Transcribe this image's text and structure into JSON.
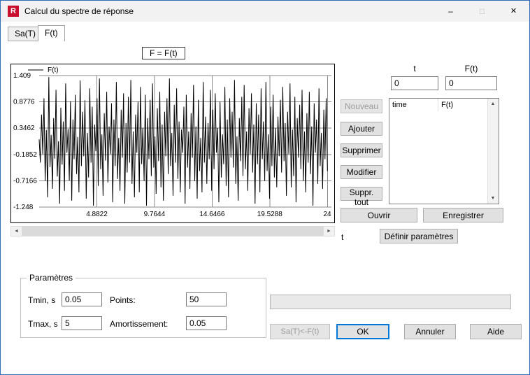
{
  "window": {
    "title": "Calcul du spectre de réponse",
    "icon_text": "R",
    "minimize_glyph": "–",
    "maximize_glyph": "□",
    "close_glyph": "✕"
  },
  "tabs": [
    {
      "label": "Sa(T)",
      "active": false
    },
    {
      "label": "F(t)",
      "active": true
    }
  ],
  "formula": "F = F(t)",
  "chart_data": {
    "type": "line",
    "legend": "F(t)",
    "xlabel": "t",
    "ylabel": "F(t)",
    "xlim": [
      0,
      24.75
    ],
    "x_end": 24.411,
    "ylim": [
      -1.248,
      1.409
    ],
    "x_ticks": [
      4.8822,
      9.7644,
      14.6466,
      19.5288,
      24.411
    ],
    "x_tick_labels": [
      "4.8822",
      "9.7644",
      "14.6466",
      "19.5288",
      "24"
    ],
    "y_ticks": [
      1.409,
      0.8776,
      0.3462,
      -0.1852,
      -0.7166,
      -1.248
    ],
    "y_tick_labels": [
      "1.409",
      "0.8776",
      "0.3462",
      "-0.1852",
      "-0.7166",
      "-1.248"
    ],
    "grid": true,
    "values": [
      0.12,
      -0.35,
      0.62,
      -0.18,
      0.95,
      -0.72,
      0.31,
      -1.05,
      1.38,
      -0.44,
      0.21,
      -0.88,
      0.55,
      -0.27,
      1.12,
      -0.63,
      0.08,
      -1.18,
      0.76,
      -0.39,
      0.48,
      -0.92,
      1.25,
      -0.15,
      0.33,
      -0.71,
      0.89,
      -1.12,
      0.52,
      -0.28,
      1.02,
      -0.58,
      0.17,
      -0.95,
      1.31,
      -0.42,
      0.68,
      -0.22,
      0.91,
      -1.08,
      0.25,
      -0.65,
      1.15,
      -0.35,
      0.78,
      -1.22,
      0.42,
      -0.12,
      0.95,
      -0.82,
      1.35,
      -0.48,
      0.22,
      -1.02,
      0.65,
      -0.31,
      1.08,
      -0.75,
      0.38,
      -0.18,
      0.85,
      -1.15,
      0.52,
      -0.42,
      1.28,
      -0.68,
      0.15,
      -0.92,
      0.72,
      -0.25,
      1.05,
      -1.18,
      0.45,
      -0.55,
      0.98,
      -0.35,
      1.32,
      -0.78,
      0.28,
      -1.05,
      0.62,
      -0.15,
      0.88,
      -0.95,
      1.18,
      -0.38,
      0.35,
      -0.72,
      1.02,
      -1.22,
      0.55,
      -0.28,
      0.92,
      -0.62,
      1.25,
      -0.45,
      0.18,
      -0.98,
      0.75,
      -0.32,
      1.08,
      -0.85,
      0.42,
      -1.12,
      0.68,
      -0.22,
      0.95,
      -0.58,
      1.35,
      -0.42,
      0.25,
      -1.02,
      0.82,
      -0.35,
      1.15,
      -0.68,
      0.48,
      -0.95,
      0.32,
      -0.15,
      0.78,
      -1.18,
      1.02,
      -0.45,
      0.28,
      -0.88,
      0.65,
      -0.25,
      1.22,
      -0.72,
      0.38,
      -1.08,
      0.92,
      -0.52,
      0.15,
      -0.95,
      1.28,
      -0.35,
      0.58,
      -0.78,
      0.45,
      -0.28,
      1.12,
      -0.92,
      0.72,
      -0.48,
      1.05,
      -0.15,
      0.35,
      -1.15,
      0.88,
      -0.65,
      0.22,
      -0.38,
      1.18,
      -0.82,
      0.52,
      -1.05,
      0.95,
      -0.25,
      0.68,
      -0.45,
      1.32,
      -0.78,
      0.18,
      -1.12,
      0.55,
      -0.32,
      0.98,
      -0.62,
      1.22,
      -0.48,
      0.28,
      -0.92,
      0.75,
      -0.18,
      1.05,
      -0.55,
      0.42,
      -1.18,
      0.85,
      -0.38,
      0.62,
      -0.95,
      1.15,
      -0.28,
      0.48,
      -0.72,
      1.28,
      -0.52,
      0.22,
      -1.08,
      0.78,
      -0.42,
      1.02,
      -0.65,
      0.35,
      -0.85,
      0.58,
      -0.22,
      0.92,
      -0.55,
      1.18,
      -0.32,
      0.45,
      -1.02,
      0.68,
      -0.18,
      1.25,
      -0.85,
      0.32,
      -0.62,
      0.98,
      -1.15,
      0.55,
      -0.25,
      0.82,
      -0.48,
      1.12,
      -0.72,
      0.28,
      -0.95,
      0.65,
      -0.35,
      1.08,
      -0.58,
      0.38,
      -1.22,
      0.85,
      -0.15,
      0.52,
      -0.78,
      1.15,
      -0.42,
      0.25,
      -0.88,
      0.72,
      -0.28,
      0.95,
      -0.52
    ]
  },
  "point_entry": {
    "t_label": "t",
    "ft_label": "F(t)",
    "t_value": "0",
    "ft_value": "0"
  },
  "edit_buttons": [
    {
      "label": "Nouveau",
      "enabled": false
    },
    {
      "label": "Ajouter",
      "enabled": true
    },
    {
      "label": "Supprimer",
      "enabled": true
    },
    {
      "label": "Modifier",
      "enabled": true
    },
    {
      "label": "Suppr. tout",
      "enabled": true
    }
  ],
  "data_table": {
    "columns": [
      "time",
      "F(t)"
    ],
    "rows": []
  },
  "file_buttons": {
    "open": "Ouvrir",
    "save": "Enregistrer"
  },
  "labels": {
    "t_axis": "t",
    "define_params": "Définir paramètres"
  },
  "parameters": {
    "title": "Paramètres",
    "tmin_label": "Tmin, s",
    "tmin_value": "0.05",
    "points_label": "Points:",
    "points_value": "50",
    "tmax_label": "Tmax, s",
    "tmax_value": "5",
    "damping_label": "Amortissement:",
    "damping_value": "0.05"
  },
  "progress": {
    "percent": 0
  },
  "action_buttons": [
    {
      "label": "Sa(T)<-F(t)",
      "enabled": false
    },
    {
      "label": "OK",
      "enabled": true,
      "default": true
    },
    {
      "label": "Annuler",
      "enabled": true
    },
    {
      "label": "Aide",
      "enabled": true
    }
  ],
  "icons": {
    "arrow_left": "◄",
    "arrow_right": "►",
    "arrow_up": "▲",
    "arrow_down": "▼"
  },
  "colors": {
    "accent": "#0078d7",
    "app_icon_bg": "#c8102e"
  }
}
